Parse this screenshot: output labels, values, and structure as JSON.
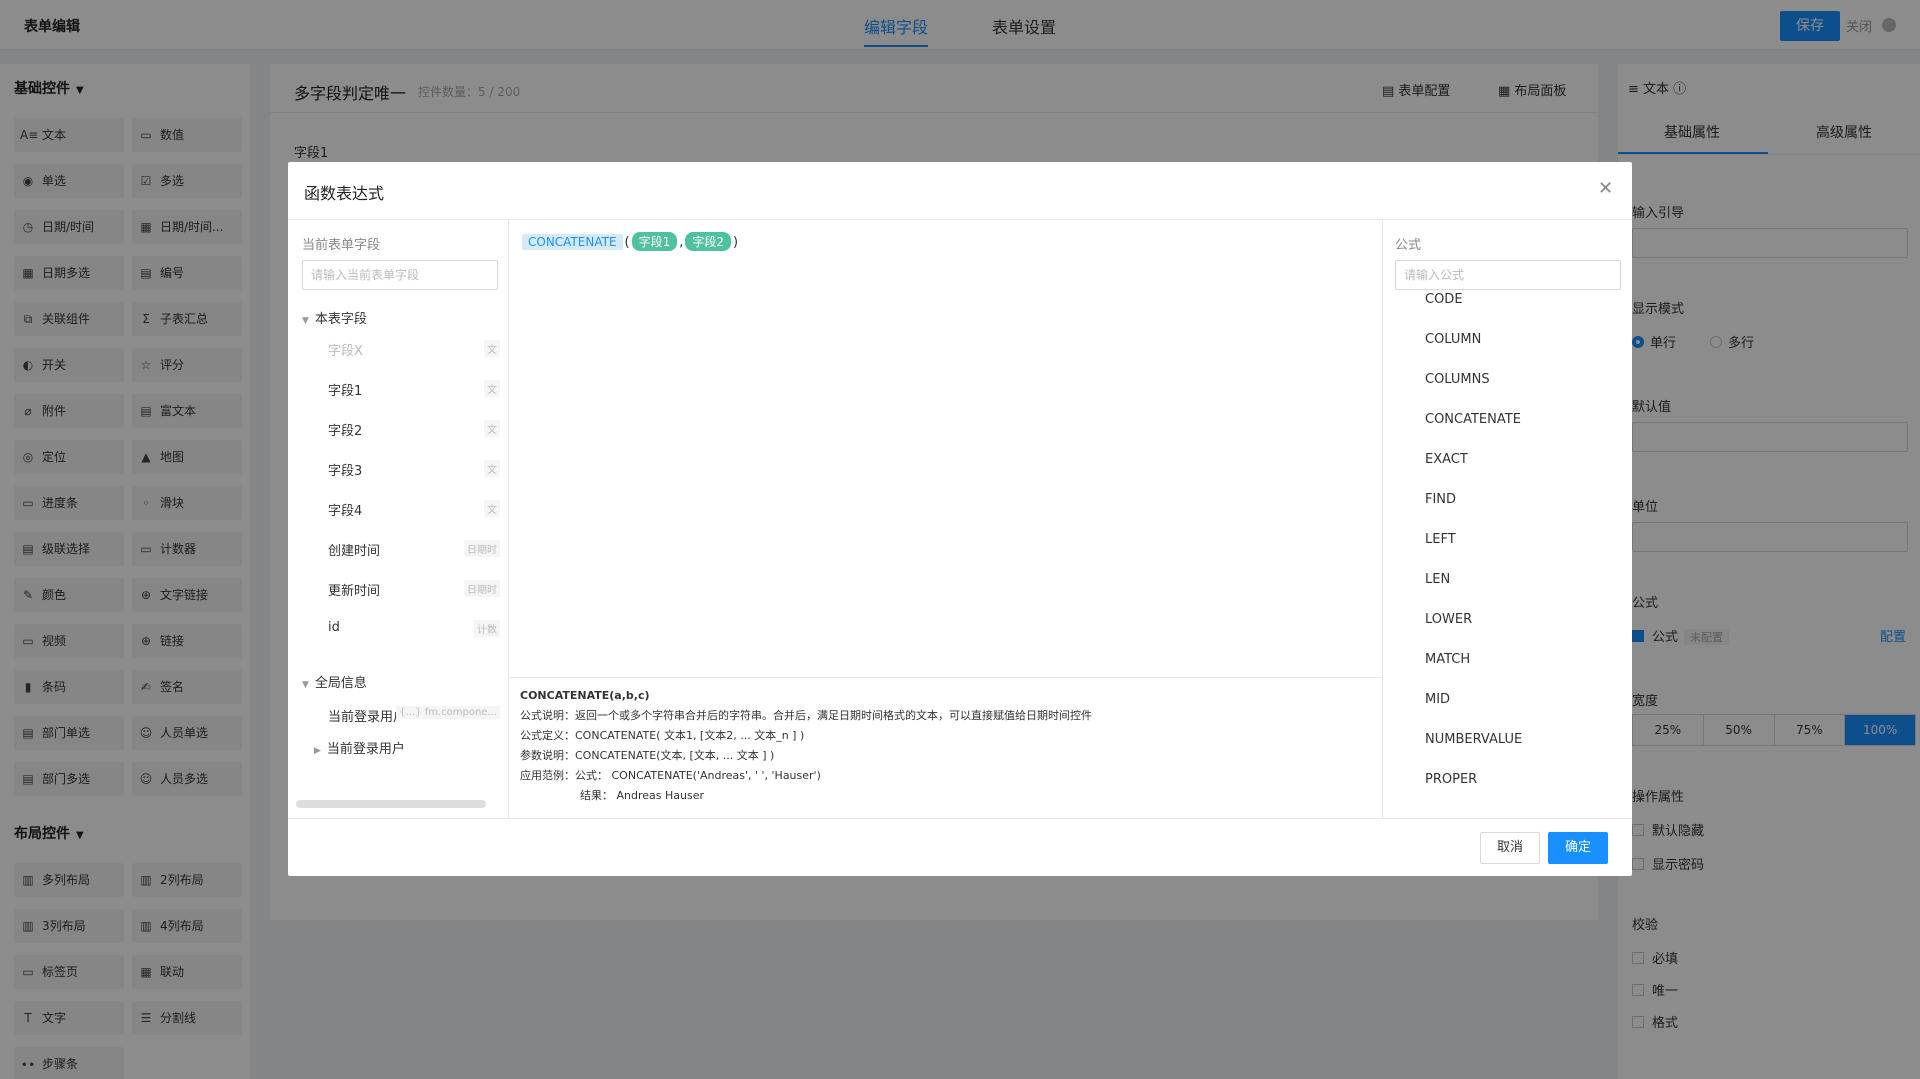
{
  "topbar": {
    "title": "表单编辑",
    "tabs": [
      "编辑字段",
      "表单设置"
    ],
    "save": "保存",
    "close": "关闭"
  },
  "left": {
    "basic_title": "基础控件",
    "layout_title": "布局控件",
    "basic": [
      [
        "文本",
        "数值"
      ],
      [
        "单选",
        "多选"
      ],
      [
        "日期/时间",
        "日期/时间..."
      ],
      [
        "日期多选",
        "编号"
      ],
      [
        "关联组件",
        "子表汇总"
      ],
      [
        "开关",
        "评分"
      ],
      [
        "附件",
        "富文本"
      ],
      [
        "定位",
        "地图"
      ],
      [
        "进度条",
        "滑块"
      ],
      [
        "级联选择",
        "计数器"
      ],
      [
        "颜色",
        "文字链接"
      ],
      [
        "视频",
        "链接"
      ],
      [
        "条码",
        "签名"
      ],
      [
        "部门单选",
        "人员单选"
      ],
      [
        "部门多选",
        "人员多选"
      ]
    ],
    "layout": [
      [
        "多列布局",
        "2列布局"
      ],
      [
        "3列布局",
        "4列布局"
      ],
      [
        "标签页",
        "联动"
      ],
      [
        "文字",
        "分割线"
      ],
      [
        "步骤条",
        ""
      ]
    ]
  },
  "canvas": {
    "title": "多字段判定唯一",
    "count": "控件数量：5 / 200",
    "tool_form_config": "表单配置",
    "tool_layout_panel": "布局面板",
    "field1": "字段1"
  },
  "right": {
    "header": "文本",
    "tab_basic": "基础属性",
    "tab_advanced": "高级属性",
    "input_guide": "输入引导",
    "display_mode": "显示模式",
    "single_line": "单行",
    "multi_line": "多行",
    "default_value": "默认值",
    "unit": "单位",
    "formula_label": "公式",
    "formula_check": "公式",
    "formula_tag": "未配置",
    "formula_link": "配置",
    "width_label": "宽度",
    "widths": [
      "25%",
      "50%",
      "75%",
      "100%"
    ],
    "ops_label": "操作属性",
    "default_hidden": "默认隐藏",
    "show_password": "显示密码",
    "validate_label": "校验",
    "required": "必填",
    "unique": "唯一",
    "format": "格式"
  },
  "modal": {
    "title": "函数表达式",
    "field_head": "当前表单字段",
    "field_search_placeholder": "请输入当前表单字段",
    "group_local": "本表字段",
    "group_global": "全局信息",
    "fields": [
      {
        "name": "字段X",
        "type": "文"
      },
      {
        "name": "字段1",
        "type": "文"
      },
      {
        "name": "字段2",
        "type": "文"
      },
      {
        "name": "字段3",
        "type": "文"
      },
      {
        "name": "字段4",
        "type": "文"
      },
      {
        "name": "创建时间",
        "type": "日期时"
      },
      {
        "name": "更新时间",
        "type": "日期时"
      },
      {
        "name": "id",
        "type": "计数"
      }
    ],
    "global_items": [
      {
        "name": "当前登录用户",
        "type": "{...} fm.compone..."
      },
      {
        "name": "当前登录用户",
        "type": ""
      }
    ],
    "expr_fn": "CONCATENATE",
    "expr_args": [
      "字段1",
      "字段2"
    ],
    "desc_name": "CONCATENATE(a,b,c)",
    "desc_explain": "公式说明：返回一个或多个字符串合并后的字符串。合并后，满足日期时间格式的文本，可以直接赋值给日期时间控件",
    "desc_def": "公式定义：CONCATENATE( 文本1, [文本2, ... 文本_n ] )",
    "desc_params": "参数说明：CONCATENATE(文本, [文本, ... 文本 ] )",
    "desc_example": "应用范例：公式：  CONCATENATE('Andreas', ' ', 'Hauser')",
    "desc_result": "结果：  Andreas Hauser",
    "formula_head": "公式",
    "formula_search_placeholder": "请输入公式",
    "formulas": [
      "CODE",
      "COLUMN",
      "COLUMNS",
      "CONCATENATE",
      "EXACT",
      "FIND",
      "LEFT",
      "LEN",
      "LOWER",
      "MATCH",
      "MID",
      "NUMBERVALUE",
      "PROPER"
    ],
    "cancel": "取消",
    "ok": "确定"
  }
}
